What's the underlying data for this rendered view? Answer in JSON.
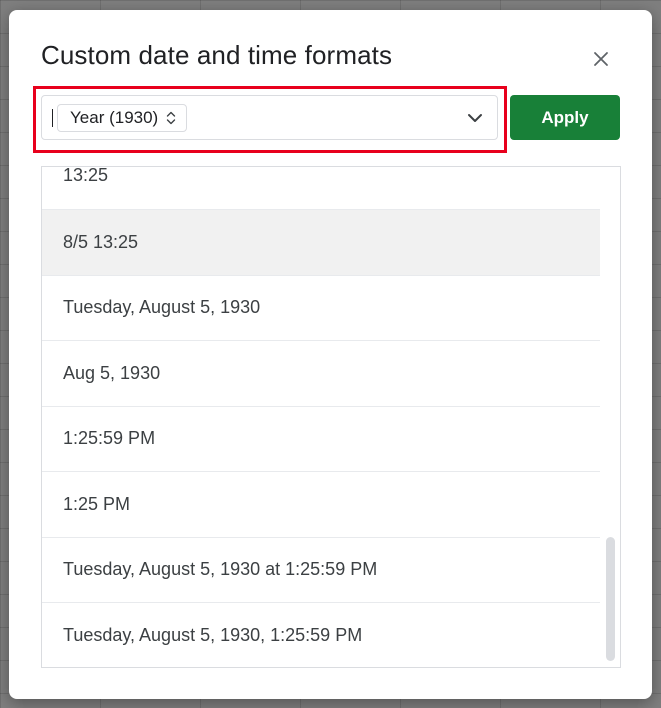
{
  "dialog": {
    "title": "Custom date and time formats",
    "close_icon": "close-icon",
    "apply_label": "Apply"
  },
  "format_input": {
    "chip_label": "Year (1930)",
    "chip_icon": "up-down-arrows-icon",
    "dropdown_icon": "chevron-down-icon"
  },
  "formats": [
    {
      "label": "13:25"
    },
    {
      "label": "8/5 13:25"
    },
    {
      "label": "Tuesday, August 5, 1930"
    },
    {
      "label": "Aug 5, 1930"
    },
    {
      "label": "1:25:59 PM"
    },
    {
      "label": "1:25 PM"
    },
    {
      "label": "Tuesday, August 5, 1930 at 1:25:59 PM"
    },
    {
      "label": "Tuesday, August 5, 1930, 1:25:59 PM"
    }
  ],
  "colors": {
    "apply_bg": "#188038",
    "highlight_border": "#e8001c",
    "selected_row_bg": "#f1f1f1"
  }
}
